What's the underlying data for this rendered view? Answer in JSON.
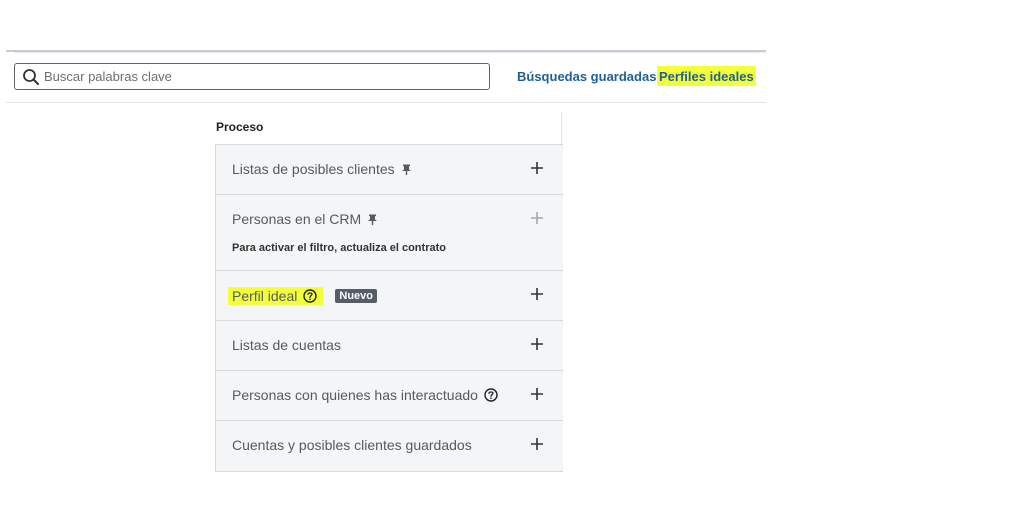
{
  "header": {
    "search_placeholder": "Buscar palabras clave",
    "saved_searches_label": "Búsquedas guardadas",
    "ideal_profiles_label": "Perfiles ideales"
  },
  "panel": {
    "title": "Proceso",
    "rows": [
      {
        "label": "Listas de posibles clientes",
        "icon": "pin-icon"
      },
      {
        "label": "Personas en el CRM",
        "icon": "pin-icon",
        "sub": "Para activar el filtro, actualiza el contrato",
        "disabled": true
      },
      {
        "label": "Perfil ideal",
        "icon": "help-icon",
        "badge": "Nuevo",
        "highlighted": true
      },
      {
        "label": "Listas de cuentas"
      },
      {
        "label": "Personas con quienes has interactuado",
        "icon": "help-icon"
      },
      {
        "label": "Cuentas y posibles clientes guardados"
      }
    ]
  },
  "colors": {
    "link": "#1f5f96",
    "highlight": "#f2ff3a",
    "panel_bg": "#f3f5f6",
    "badge_bg": "#555d66"
  }
}
